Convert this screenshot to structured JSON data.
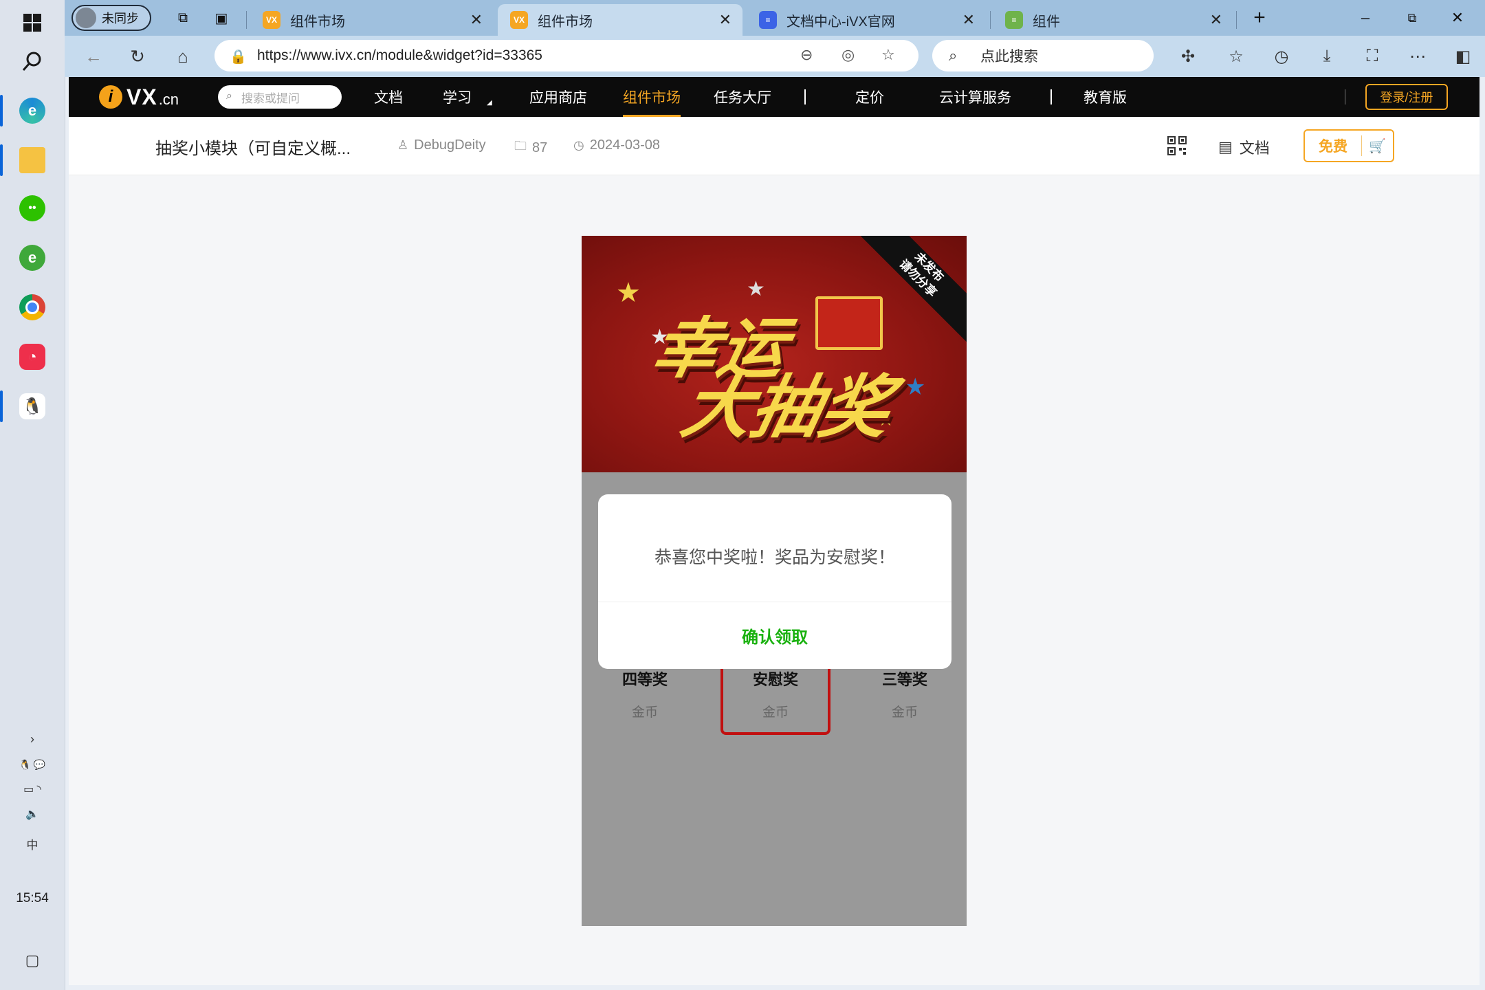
{
  "browser": {
    "profile_label": "未同步",
    "tabs": [
      {
        "title": "组件市场"
      },
      {
        "title": "组件市场"
      },
      {
        "title": "文档中心-iVX官网"
      },
      {
        "title": "组件"
      }
    ],
    "address": "https://www.ivx.cn/module&widget?id=33365",
    "search_placeholder": "点此搜索"
  },
  "taskbar": {
    "time": "15:54",
    "ime": "中"
  },
  "site": {
    "logo_vx": "VX",
    "logo_cn": ".cn",
    "search_placeholder": "搜索或提问",
    "nav": [
      "文档",
      "学习",
      "应用商店",
      "组件市场",
      "任务大厅",
      "定价",
      "云计算服务",
      "教育版"
    ],
    "login_label": "登录/注册"
  },
  "widget_info": {
    "title": "抽奖小模块（可自定义概...",
    "author": "DebugDeity",
    "count": "87",
    "date": "2024-03-08",
    "doc_label": "文档",
    "free_label": "免费"
  },
  "preview": {
    "banner_line1": "幸运",
    "banner_line2": "大抽奖",
    "ribbon_line1": "未发布",
    "ribbon_line2": "请勿分享",
    "prizes": [
      {
        "name": "四等奖",
        "coin": "金币"
      },
      {
        "name": "安慰奖",
        "coin": "金币"
      },
      {
        "name": "三等奖",
        "coin": "金币"
      }
    ],
    "dialog_message": "恭喜您中奖啦！奖品为安慰奖！",
    "dialog_confirm": "确认领取"
  },
  "colors": {
    "accent": "#f5a623",
    "confirm_green": "#19b10e",
    "selected_border": "#c11010"
  }
}
